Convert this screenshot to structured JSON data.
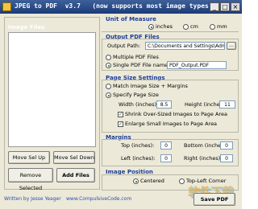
{
  "window": {
    "title": "JPEG to PDF  v3.7   (now supports most image types)"
  },
  "title_buttons": {
    "minimize": "_",
    "maximize": "□",
    "close": "×"
  },
  "left": {
    "group_label": "Image Files",
    "buttons": {
      "move_up": "Move Sel Up",
      "move_down": "Move Sel Down",
      "remove": "Remove Selected",
      "add": "Add Files"
    }
  },
  "footer": {
    "author": "Written by Jesse Yeager",
    "website": "www.CompulsiveCode.com"
  },
  "unit": {
    "title": "Unit of Measure",
    "inches": "inches",
    "cm": "cm",
    "mm": "mm",
    "selected": "inches"
  },
  "output": {
    "title": "Output PDF Files",
    "path_label": "Output Path:",
    "path_value": "C:\\Documents and Settings\\Administrat",
    "browse": "...",
    "multiple": "Multiple PDF Files",
    "single": "Single PDF File named:",
    "single_name": "PDF_Output.PDF",
    "selected": "single"
  },
  "page_size": {
    "title": "Page Size Settings",
    "match": "Match Image Size + Margins",
    "specify": "Specify Page Size",
    "width_label": "Width (inches):",
    "width": "8.5",
    "height_label": "Height (inches):",
    "height": "11",
    "shrink": "Shrink Over-Sized Images to Page Area",
    "enlarge": "Enlarge Small Images to Page Area",
    "selected": "specify"
  },
  "margins": {
    "title": "Margins",
    "top_label": "Top (inches):",
    "top": "0",
    "bottom_label": "Bottom (inches):",
    "bottom": "0",
    "left_label": "Left (inches):",
    "left": "0",
    "right_label": "Right (inches):",
    "right": "0"
  },
  "position": {
    "title": "Image Position",
    "centered": "Centered",
    "top_left": "Top-Left Corner",
    "selected": "centered"
  },
  "save_button": "Save PDF",
  "watermark": "软件下载"
}
